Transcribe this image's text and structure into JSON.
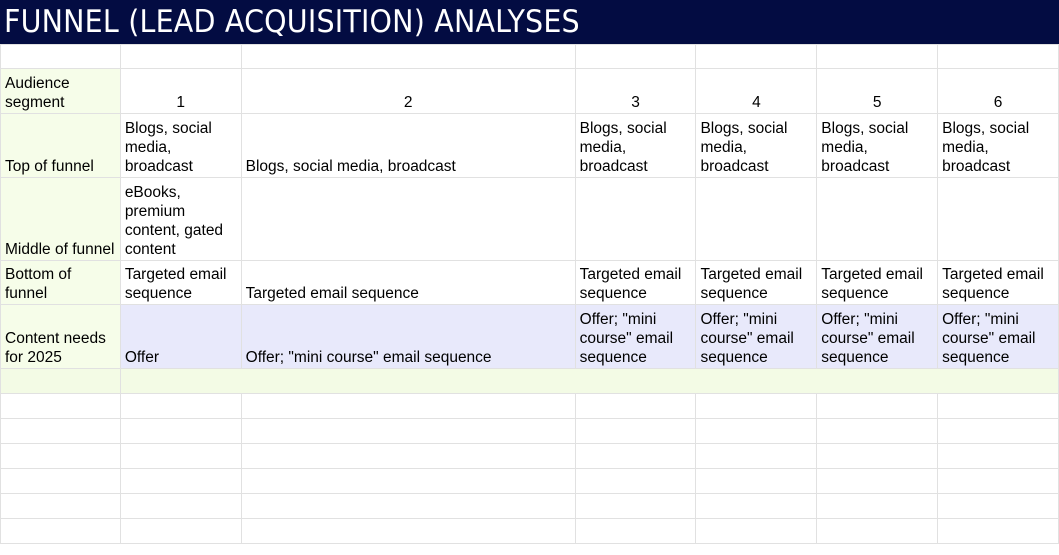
{
  "title": "FUNNEL (LEAD ACQUISITION) ANALYSES",
  "rows": {
    "audience_segment": {
      "label": "Audience segment",
      "values": [
        "1",
        "2",
        "3",
        "4",
        "5",
        "6"
      ]
    },
    "top_of_funnel": {
      "label": "Top of funnel",
      "values": [
        "Blogs, social media, broadcast",
        "Blogs, social media, broadcast",
        "Blogs, social media, broadcast",
        "Blogs, social media, broadcast",
        "Blogs, social media, broadcast",
        "Blogs, social media, broadcast"
      ]
    },
    "middle_of_funnel": {
      "label": "Middle of funnel",
      "values": [
        "eBooks, premium content, gated content",
        "",
        "",
        "",
        "",
        ""
      ]
    },
    "bottom_of_funnel": {
      "label": "Bottom of funnel",
      "values": [
        "Targeted email sequence",
        "Targeted email sequence",
        "Targeted email sequence",
        "Targeted email sequence",
        "Targeted email sequence",
        "Targeted email sequence"
      ]
    },
    "content_needs": {
      "label": "Content needs for 2025",
      "values": [
        "Offer",
        "Offer; \"mini course\" email sequence",
        "Offer; \"mini course\" email sequence",
        "Offer; \"mini course\" email sequence",
        "Offer; \"mini course\" email sequence",
        "Offer; \"mini course\" email sequence"
      ]
    }
  },
  "colors": {
    "banner": "#030c42",
    "label_bg": "#f6fde9",
    "content_needs_bg": "#e8e9fb"
  }
}
